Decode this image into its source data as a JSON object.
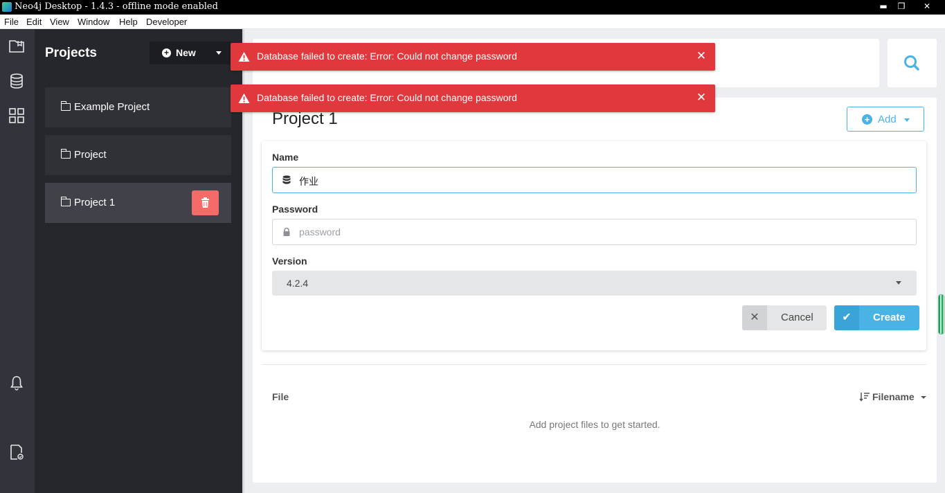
{
  "window": {
    "title": "Neo4j Desktop - 1.4.3 - offline mode enabled",
    "minimize_glyph": "▬",
    "restore_glyph": "❐",
    "close_glyph": "✕"
  },
  "menu": [
    "File",
    "Edit",
    "View",
    "Window",
    "Help",
    "Developer"
  ],
  "rail": {
    "icons": [
      "projects-icon",
      "database-icon",
      "apps-grid-icon",
      "notifications-bell-icon",
      "settings-document-icon"
    ]
  },
  "sidebar": {
    "title": "Projects",
    "new_button": "New",
    "new_plus": "+",
    "projects": [
      {
        "label": "Example Project"
      },
      {
        "label": "Project"
      },
      {
        "label": "Project 1",
        "active": true
      }
    ]
  },
  "toasts": [
    {
      "message": "Database failed to create: Error: Could not change password",
      "close": "✕"
    },
    {
      "message": "Database failed to create: Error: Could not change password",
      "close": "✕"
    }
  ],
  "main": {
    "project_title": "Project 1",
    "add_button": "Add",
    "add_plus": "+",
    "form": {
      "name_label": "Name",
      "name_value": "作业",
      "password_label": "Password",
      "password_placeholder": "password",
      "version_label": "Version",
      "version_value": "4.2.4",
      "cancel_label": "Cancel",
      "cancel_glyph": "✕",
      "create_label": "Create",
      "create_glyph": "✔"
    },
    "files": {
      "heading": "File",
      "sort_label": "Filename",
      "empty_message": "Add project files to get started."
    }
  },
  "colors": {
    "accent": "#4ab3e6",
    "error": "#e0383c",
    "delete": "#f46b69",
    "sidebar_bg": "#25272d",
    "rail_bg": "#32343b"
  }
}
